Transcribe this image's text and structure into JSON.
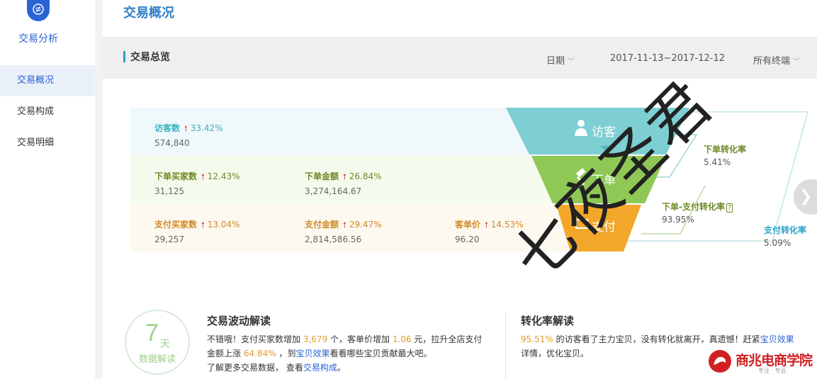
{
  "sidebar": {
    "logo_icon": "exchange-icon",
    "title": "交易分析",
    "items": [
      {
        "label": "交易概况",
        "active": true
      },
      {
        "label": "交易构成",
        "active": false
      },
      {
        "label": "交易明细",
        "active": false
      }
    ]
  },
  "page": {
    "title": "交易概况"
  },
  "section": {
    "title": "交易总览",
    "filters": {
      "date_label": "日期",
      "date_range": "2017-11-13~2017-12-12",
      "terminal": "所有终端"
    }
  },
  "metrics": {
    "visitors": {
      "label": "访客数",
      "change": "33.42%",
      "value": "574,840"
    },
    "order_buyers": {
      "label": "下单买家数",
      "change": "12.43%",
      "value": "31,125"
    },
    "order_amount": {
      "label": "下单金额",
      "change": "26.84%",
      "value": "3,274,164.67"
    },
    "pay_buyers": {
      "label": "支付买家数",
      "change": "13.04%",
      "value": "29,257"
    },
    "pay_amount": {
      "label": "支付金额",
      "change": "29.47%",
      "value": "2,814,586.56"
    },
    "unit_price": {
      "label": "客单价",
      "change": "14.53%",
      "value": "96.20"
    }
  },
  "funnel": {
    "stage1": "访客",
    "stage2": "下单",
    "stage3": "支付",
    "rate_order": {
      "label": "下单转化率",
      "value": "5.41%"
    },
    "rate_order_pay": {
      "label": "下单-支付转化率",
      "value": "93.95%"
    },
    "rate_pay": {
      "label": "支付转化率",
      "value": "5.09%"
    },
    "colors": {
      "visitor": "#7dcfd3",
      "order": "#8fc855",
      "pay": "#f2a72a"
    }
  },
  "watermark": "七夜圣君",
  "badge": {
    "num": "7",
    "unit": "天",
    "text": "数据解读"
  },
  "wave": {
    "title": "交易波动解读",
    "t1": "不错哦！支付买家数增加",
    "n1": "3,679",
    "t2": "个，客单价增加",
    "n2": "1.06",
    "t3": "元，拉升全店支付",
    "t4": "金额上涨",
    "n3": "64.84%",
    "t5": "，到",
    "link1": "宝贝效果",
    "t6": "看看哪些宝贝贡献最大吧。",
    "t7": "了解更多交易数据，",
    "t8": "查看",
    "link2": "交易构成",
    "t9": "。"
  },
  "conv": {
    "title": "转化率解读",
    "n1": "95.51%",
    "t1": "的访客看了主力宝贝，没有转化就离开，真遗憾！赶紧",
    "link1": "宝贝效果",
    "t2": "详情，优化宝贝。"
  },
  "brand": {
    "name": "商兆电商学院",
    "slogan": "专注 · 专业"
  }
}
